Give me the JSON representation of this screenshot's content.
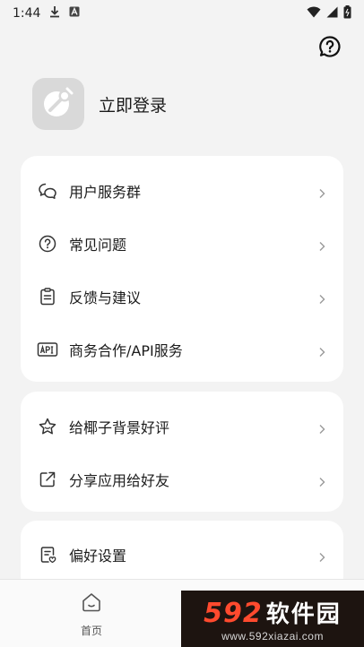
{
  "status_bar": {
    "time": "1:44"
  },
  "profile": {
    "login_label": "立即登录"
  },
  "card1": {
    "items": [
      {
        "label": "用户服务群"
      },
      {
        "label": "常见问题"
      },
      {
        "label": "反馈与建议"
      },
      {
        "label": "商务合作/API服务"
      }
    ]
  },
  "card2": {
    "items": [
      {
        "label": "给椰子背景好评"
      },
      {
        "label": "分享应用给好友"
      }
    ]
  },
  "card3": {
    "items": [
      {
        "label": "偏好设置"
      }
    ]
  },
  "bottom_nav": {
    "home_label": "首页"
  },
  "watermark": {
    "number": "592",
    "text": "软件园",
    "url": "www.592xiazai.com"
  },
  "colors": {
    "background": "#f3f3f3",
    "card": "#ffffff",
    "watermark_accent": "#ff4a2e"
  }
}
